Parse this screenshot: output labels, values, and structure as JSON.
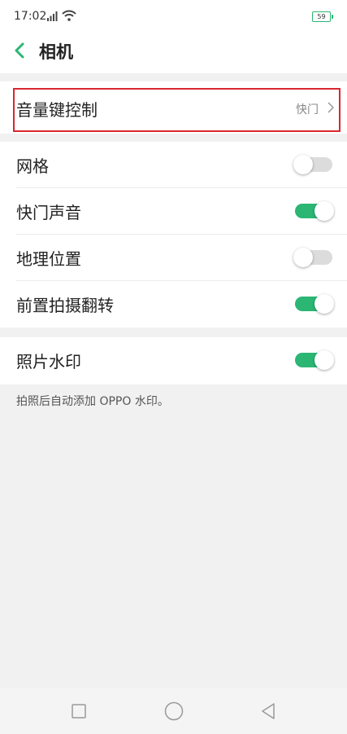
{
  "status_bar": {
    "time": "17:02",
    "battery": "59"
  },
  "header": {
    "title": "相机"
  },
  "volume_key": {
    "label": "音量键控制",
    "value": "快门"
  },
  "settings": {
    "grid": {
      "label": "网格",
      "enabled": false
    },
    "shutter_sound": {
      "label": "快门声音",
      "enabled": true
    },
    "location": {
      "label": "地理位置",
      "enabled": false
    },
    "front_mirror": {
      "label": "前置拍摄翻转",
      "enabled": true
    }
  },
  "watermark": {
    "label": "照片水印",
    "enabled": true
  },
  "footnote": "拍照后自动添加 OPPO 水印。",
  "colors": {
    "accent": "#2bb673",
    "highlight_border": "#d9272e"
  },
  "nav_bar": {
    "icons": [
      "recents-square-icon",
      "home-circle-icon",
      "back-triangle-icon"
    ]
  }
}
